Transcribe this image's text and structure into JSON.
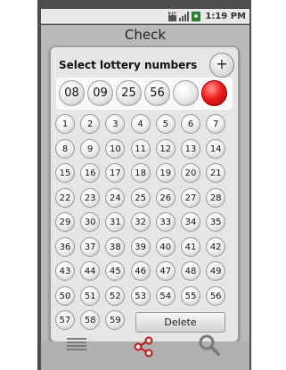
{
  "status_bar": {
    "network": "3G",
    "time": "1:19 PM"
  },
  "app_title": "Check",
  "dialog": {
    "title": "Select lottery numbers",
    "add_label": "+",
    "selected_numbers": [
      "08",
      "09",
      "25",
      "56",
      "",
      ""
    ],
    "numbers": [
      "1",
      "2",
      "3",
      "4",
      "5",
      "6",
      "7",
      "8",
      "9",
      "10",
      "11",
      "12",
      "13",
      "14",
      "15",
      "16",
      "17",
      "18",
      "19",
      "20",
      "21",
      "22",
      "23",
      "24",
      "25",
      "26",
      "27",
      "28",
      "29",
      "30",
      "31",
      "32",
      "33",
      "34",
      "35",
      "36",
      "37",
      "38",
      "39",
      "40",
      "41",
      "42",
      "43",
      "44",
      "45",
      "46",
      "47",
      "48",
      "49",
      "50",
      "51",
      "52",
      "53",
      "54",
      "55",
      "56",
      "57",
      "58",
      "59"
    ],
    "delete_label": "Delete"
  },
  "bottom_nav": [
    {
      "icon": "list-icon"
    },
    {
      "icon": "share-icon",
      "color": "#b71c1c"
    },
    {
      "icon": "search-icon"
    }
  ],
  "colors": {
    "selected_red_ball": "#e01818",
    "frame": "#4d4d4d"
  }
}
